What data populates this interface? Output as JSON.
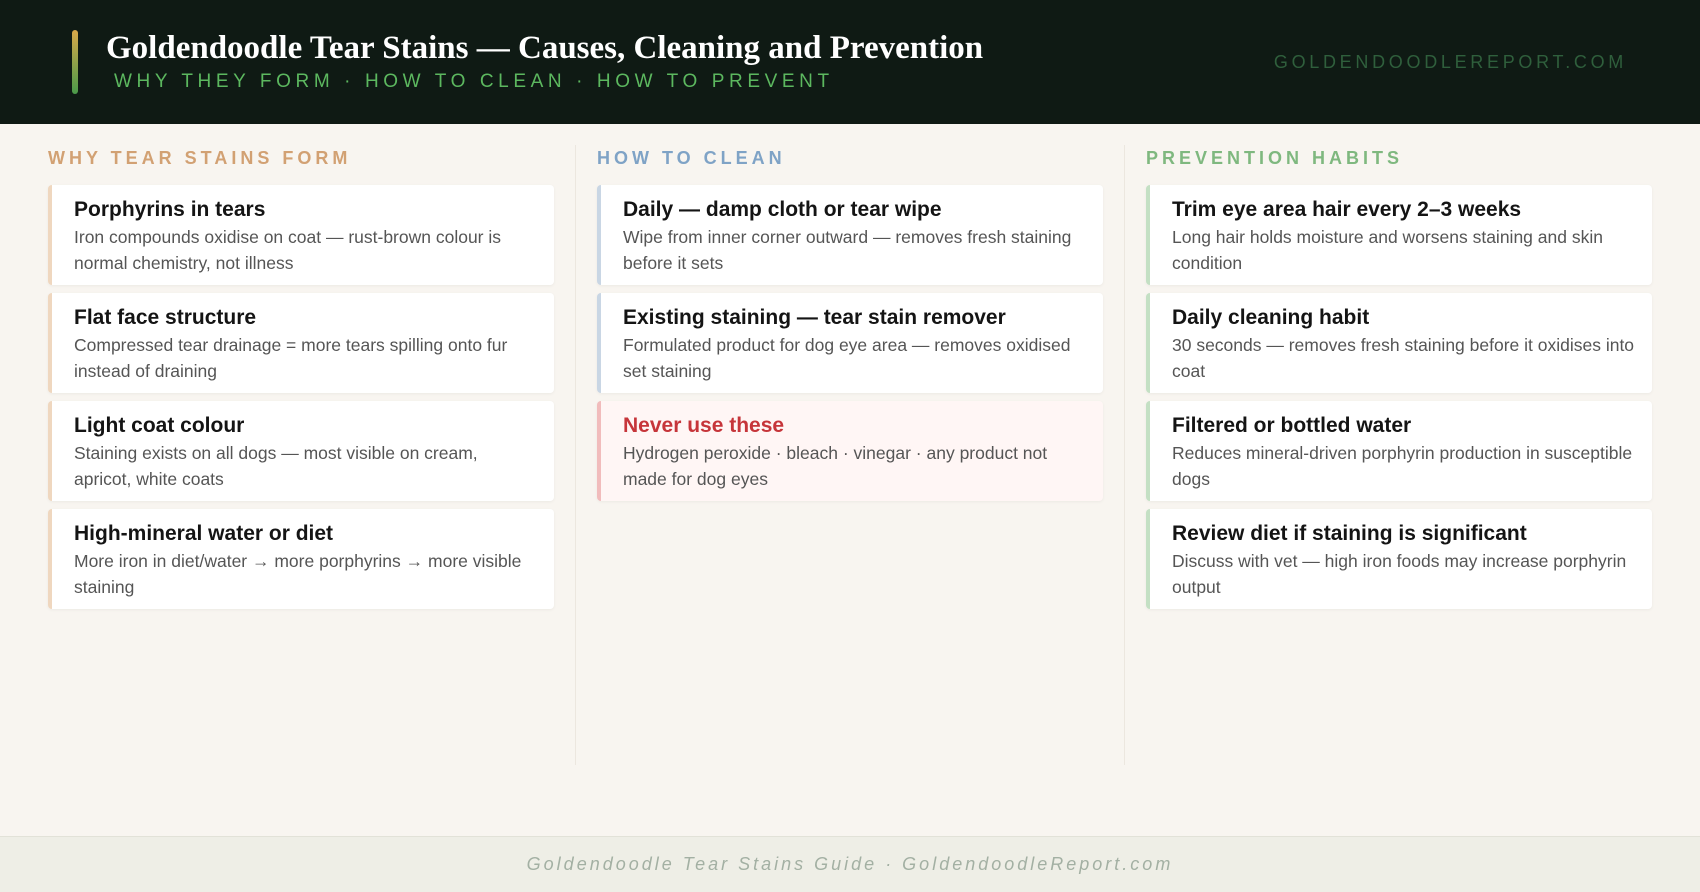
{
  "header": {
    "title": "Goldendoodle Tear Stains — Causes, Cleaning and Prevention",
    "subtitle": "WHY THEY FORM · HOW TO CLEAN · HOW TO PREVENT",
    "domain": "GOLDENDOODLEREPORT.COM"
  },
  "columns": [
    {
      "heading": "WHY TEAR STAINS FORM",
      "color": "#d2a173",
      "cards": [
        {
          "title": "Porphyrins in tears",
          "text": "Iron compounds oxidise on coat — rust-brown colour is normal chemistry, not illness"
        },
        {
          "title": "Flat face structure",
          "text": "Compressed tear drainage = more tears spilling onto fur instead of draining"
        },
        {
          "title": "Light coat colour",
          "text": "Staining exists on all dogs — most visible on cream, apricot, white coats"
        },
        {
          "title": "High-mineral water or diet",
          "text": "More iron in diet/water → more porphyrins → more visible staining"
        }
      ]
    },
    {
      "heading": "HOW TO CLEAN",
      "color": "#7fa3c6",
      "cards": [
        {
          "title": "Daily — damp cloth or tear wipe",
          "text": "Wipe from inner corner outward — removes fresh staining before it sets"
        },
        {
          "title": "Existing staining — tear stain remover",
          "text": "Formulated product for dog eye area — removes oxidised set staining"
        },
        {
          "title": "Never use these",
          "text": "Hydrogen peroxide · bleach · vinegar · any product not made for dog eyes"
        }
      ]
    },
    {
      "heading": "PREVENTION HABITS",
      "color": "#7fb87f",
      "cards": [
        {
          "title": "Trim eye area hair every 2–3 weeks",
          "text": "Long hair holds moisture and worsens staining and skin condition"
        },
        {
          "title": "Daily cleaning habit",
          "text": "30 seconds — removes fresh staining before it oxidises into coat"
        },
        {
          "title": "Filtered or bottled water",
          "text": "Reduces mineral-driven porphyrin production in susceptible dogs"
        },
        {
          "title": "Review diet if staining is significant",
          "text": "Discuss with vet — high iron foods may increase porphyrin output"
        }
      ]
    }
  ],
  "footer": {
    "text": "Goldendoodle Tear Stains Guide · GoldendoodleReport.com"
  }
}
